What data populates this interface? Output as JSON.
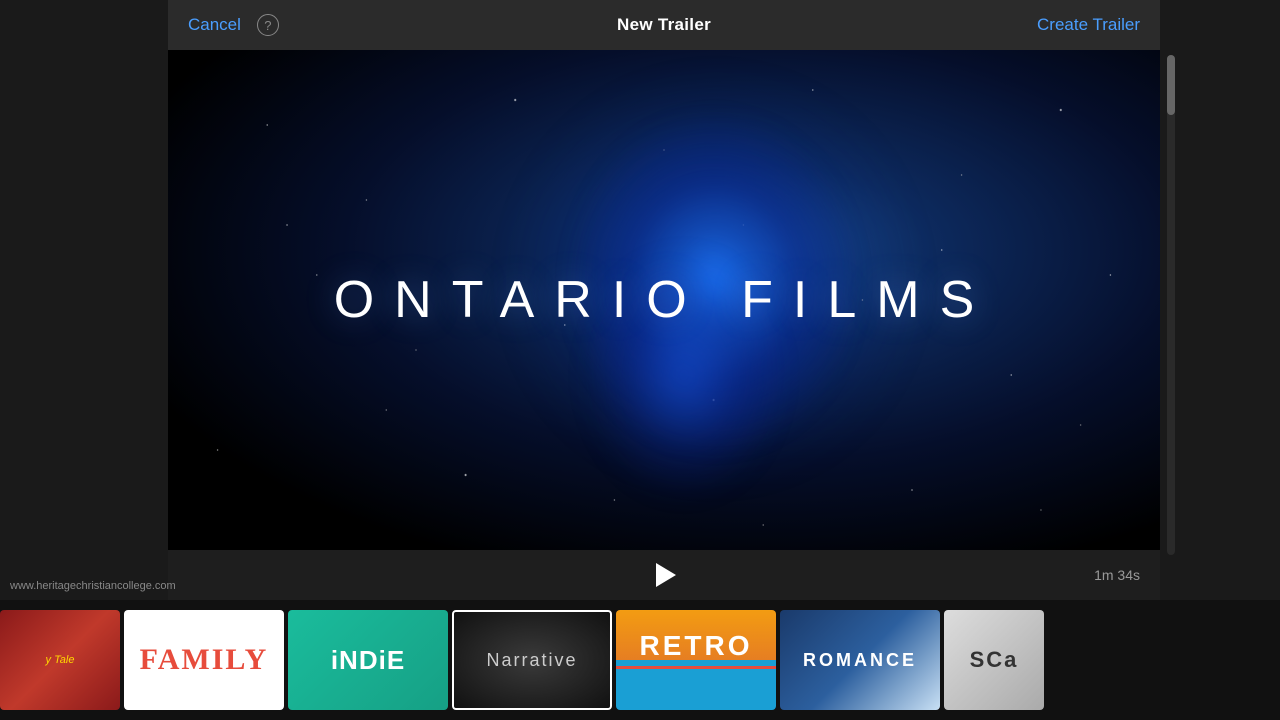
{
  "header": {
    "cancel_label": "Cancel",
    "help_label": "?",
    "title": "New Trailer",
    "create_label": "Create Trailer"
  },
  "preview": {
    "main_text": "ONTARIO FILMS",
    "duration": "1m 34s"
  },
  "thumbnails": [
    {
      "id": "fairytale",
      "label": "Fairy Tale",
      "selected": false
    },
    {
      "id": "family",
      "label": "FAMILY",
      "selected": false
    },
    {
      "id": "indie",
      "label": "iNDiE",
      "selected": false
    },
    {
      "id": "narrative",
      "label": "Narrative",
      "selected": true
    },
    {
      "id": "retro",
      "label": "RETRO",
      "selected": false
    },
    {
      "id": "romance",
      "label": "ROMANCE",
      "selected": false
    },
    {
      "id": "scary",
      "label": "SCa...",
      "selected": false
    }
  ],
  "watermark": {
    "text": "www.heritagechristiancollege.com"
  },
  "play_button_label": "▶"
}
